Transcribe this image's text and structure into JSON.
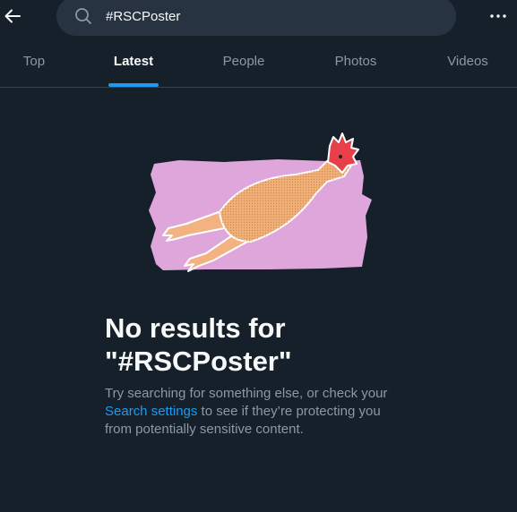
{
  "search": {
    "value": "#RSCPoster"
  },
  "tabs": [
    {
      "label": "Top"
    },
    {
      "label": "Latest"
    },
    {
      "label": "People"
    },
    {
      "label": "Photos"
    },
    {
      "label": "Videos"
    }
  ],
  "active_tab": "Latest",
  "empty_state": {
    "title_line1": "No results for",
    "title_line2": "\"#RSCPoster\"",
    "desc_before": "Try searching for something else, or check your ",
    "link_label": "Search settings",
    "desc_after": " to see if they’re protecting you from potentially sensitive content."
  },
  "colors": {
    "background": "#15202b",
    "search_bg": "#273340",
    "accent": "#1d9bf0",
    "secondary_text": "#8b98a5"
  },
  "icons": {
    "back": "arrow-left-icon",
    "search": "search-icon",
    "more": "more-horizontal-icon"
  }
}
